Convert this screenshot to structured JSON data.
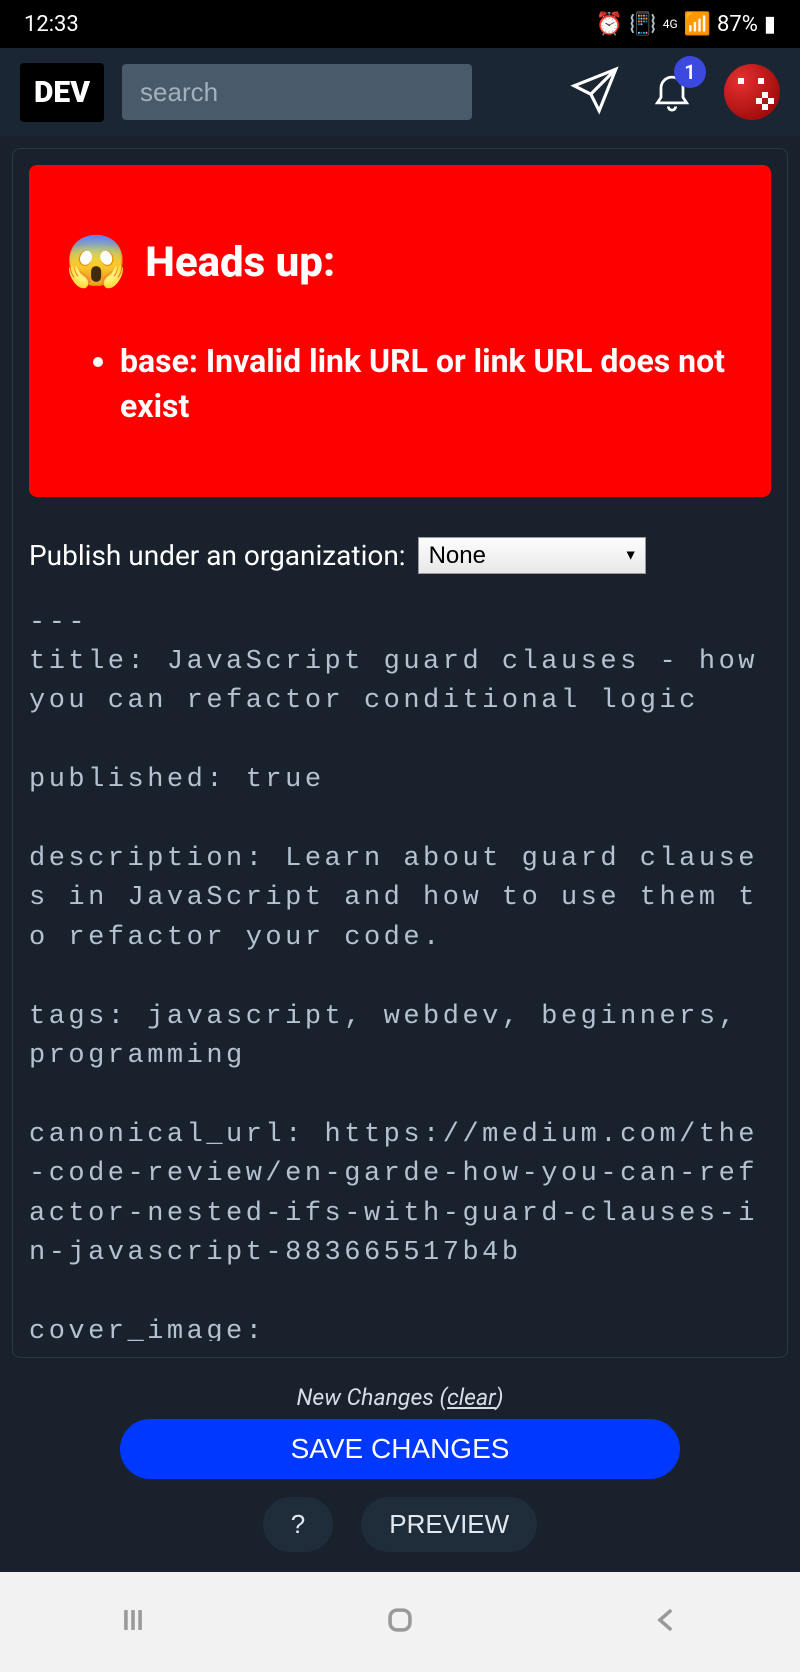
{
  "status": {
    "time": "12:33",
    "network": "4G",
    "battery": "87%"
  },
  "header": {
    "logo": "DEV",
    "search_placeholder": "search",
    "notification_count": "1"
  },
  "alert": {
    "emoji": "😱",
    "title": "Heads up:",
    "items": [
      "base:  Invalid link URL or link URL does not exist"
    ]
  },
  "org": {
    "label": "Publish under an organization:",
    "selected": "None"
  },
  "editor": {
    "content": "---\ntitle: JavaScript guard clauses - how you can refactor conditional logic\n\npublished: true\n\ndescription: Learn about guard clauses in JavaScript and how to use them to refactor your code.\n\ntags: javascript, webdev, beginners, programming\n\ncanonical_url: https://medium.com/the-code-review/en-garde-how-you-can-refactor-nested-ifs-with-guard-clauses-in-javascript-883665517b4b\n\ncover_image: "
  },
  "bottom": {
    "changes_text": "New Changes (",
    "clear_text": "clear",
    "changes_suffix": ")",
    "save": "SAVE CHANGES",
    "help": "?",
    "preview": "PREVIEW"
  }
}
